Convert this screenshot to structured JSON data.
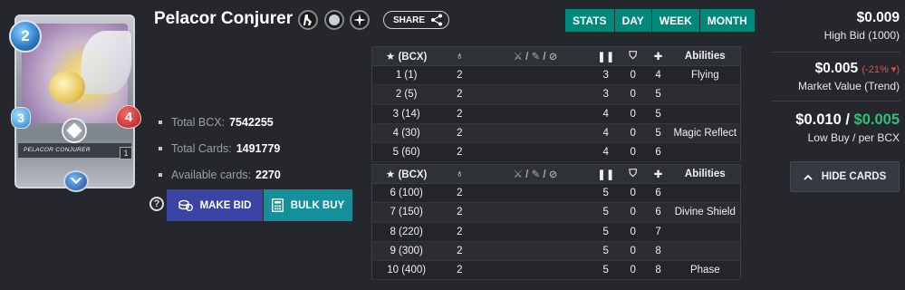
{
  "card": {
    "name": "Pelacor Conjurer",
    "image_name_text": "PELACOR CONJURER",
    "mana": "2",
    "speed": "3",
    "health": "4",
    "level": "1"
  },
  "header": {
    "share_label": "SHARE"
  },
  "tabs": [
    "STATS",
    "DAY",
    "WEEK",
    "MONTH"
  ],
  "stats": {
    "total_bcx_label": "Total BCX:",
    "total_bcx": "7542255",
    "total_cards_label": "Total Cards:",
    "total_cards": "1491779",
    "available_label": "Available cards:",
    "available": "2270"
  },
  "actions": {
    "help": "?",
    "make_bid": "MAKE BID",
    "bulk_buy": "BULK BUY"
  },
  "table": {
    "headers": {
      "level": "(BCX)",
      "abilities": "Abilities"
    },
    "rows_top": [
      {
        "level": "1 (1)",
        "mana": "2",
        "attack": "",
        "speed": "3",
        "armor": "0",
        "health": "4",
        "ability": "Flying"
      },
      {
        "level": "2 (5)",
        "mana": "2",
        "attack": "",
        "speed": "3",
        "armor": "0",
        "health": "5",
        "ability": ""
      },
      {
        "level": "3 (14)",
        "mana": "2",
        "attack": "",
        "speed": "4",
        "armor": "0",
        "health": "5",
        "ability": ""
      },
      {
        "level": "4 (30)",
        "mana": "2",
        "attack": "",
        "speed": "4",
        "armor": "0",
        "health": "5",
        "ability": "Magic Reflect"
      },
      {
        "level": "5 (60)",
        "mana": "2",
        "attack": "",
        "speed": "4",
        "armor": "0",
        "health": "6",
        "ability": ""
      }
    ],
    "rows_bottom": [
      {
        "level": "6 (100)",
        "mana": "2",
        "attack": "",
        "speed": "5",
        "armor": "0",
        "health": "6",
        "ability": ""
      },
      {
        "level": "7 (150)",
        "mana": "2",
        "attack": "",
        "speed": "5",
        "armor": "0",
        "health": "6",
        "ability": "Divine Shield"
      },
      {
        "level": "8 (220)",
        "mana": "2",
        "attack": "",
        "speed": "5",
        "armor": "0",
        "health": "7",
        "ability": ""
      },
      {
        "level": "9 (300)",
        "mana": "2",
        "attack": "",
        "speed": "5",
        "armor": "0",
        "health": "8",
        "ability": ""
      },
      {
        "level": "10 (400)",
        "mana": "2",
        "attack": "",
        "speed": "5",
        "armor": "0",
        "health": "8",
        "ability": "Phase"
      }
    ]
  },
  "market": {
    "high_bid": "$0.009",
    "high_bid_label": "High Bid (1000)",
    "market_value": "$0.005",
    "trend": "(-21%",
    "market_value_label": "Market Value (Trend)",
    "low_buy": "$0.010",
    "slash": "/",
    "per_bcx": "$0.005",
    "low_buy_label": "Low Buy / per BCX",
    "hide_cards": "HIDE CARDS"
  },
  "colors": {
    "accent_teal": "#00897b",
    "bid_button": "#3a44a4",
    "bulk_button": "#13909a",
    "trend_down": "#e0504b",
    "per_bcx_green": "#2fc17b"
  },
  "icons": {
    "melee": "melee-attack-icon",
    "neutral": "neutral-element-icon",
    "rarity": "rarity-icon",
    "share": "share-icon",
    "bid": "coins-icon",
    "bulk": "calculator-icon",
    "hide": "chevron-up-icon"
  }
}
